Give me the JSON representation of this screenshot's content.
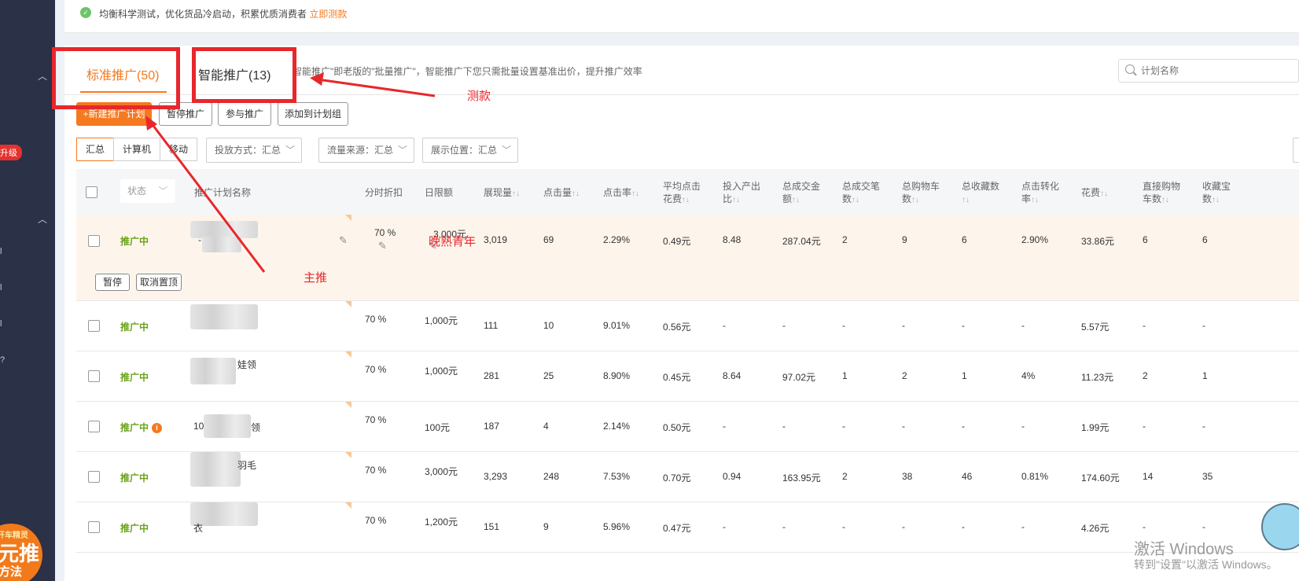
{
  "notice": {
    "text": "均衡科学测试，优化货品冷启动，积累优质消费者",
    "link": "立即测款"
  },
  "sidebar": {
    "badge": "升级",
    "promo_line1": "开车精灵",
    "promo_line2": "元推",
    "promo_line3": "方法"
  },
  "tabs": {
    "standard": "标准推广(50)",
    "smart": "智能推广(13)",
    "description": "智能推广\"即老版的\"批量推广\"，智能推广下您只需批量设置基准出价，提升推广效率"
  },
  "search": {
    "placeholder": "计划名称"
  },
  "toolbar": {
    "new_plan": "+新建推广计划",
    "pause": "暂停推广",
    "join": "参与推广",
    "add_group": "添加到计划组"
  },
  "filters": {
    "segments": [
      "汇总",
      "计算机",
      "移动"
    ],
    "delivery": "投放方式：汇总",
    "traffic": "流量来源：汇总",
    "placement": "展示位置：汇总"
  },
  "table": {
    "status_filter": "状态",
    "headers": {
      "name": "推广计划名称",
      "discount": "分时折扣",
      "budget": "日限额",
      "impressions": "展现量",
      "clicks": "点击量",
      "ctr": "点击率",
      "avg_cpc_1": "平均点击",
      "avg_cpc_2": "花费",
      "roi_1": "投入产出",
      "roi_2": "比",
      "gmv_1": "总成交金",
      "gmv_2": "额",
      "orders_1": "总成交笔",
      "orders_2": "数",
      "cart_1": "总购物车",
      "cart_2": "数",
      "fav_1": "总收藏数",
      "fav_2": "",
      "cvr_1": "点击转化",
      "cvr_2": "率",
      "cost": "花费",
      "direct_cart_1": "直接购物",
      "direct_cart_2": "车数",
      "fav_item_1": "收藏宝",
      "fav_item_2": "数"
    },
    "sort_glyph": "↑↓",
    "row_actions": {
      "pause": "暂停",
      "unpin": "取消置顶"
    },
    "rows": [
      {
        "status": "推广中",
        "name": "-",
        "discount": "70 %",
        "budget": "3,000元",
        "impressions": "3,019",
        "clicks": "69",
        "ctr": "2.29%",
        "cpc": "0.49元",
        "roi": "8.48",
        "gmv": "287.04元",
        "orders": "2",
        "cart": "9",
        "fav": "6",
        "cvr": "2.90%",
        "cost": "33.86元",
        "direct_cart": "6",
        "fav_item": "6"
      },
      {
        "status": "推广中",
        "name": "",
        "discount": "70 %",
        "budget": "1,000元",
        "impressions": "111",
        "clicks": "10",
        "ctr": "9.01%",
        "cpc": "0.56元",
        "roi": "-",
        "gmv": "-",
        "orders": "-",
        "cart": "-",
        "fav": "-",
        "cvr": "-",
        "cost": "5.57元",
        "direct_cart": "-",
        "fav_item": "-"
      },
      {
        "status": "推广中",
        "name": "娃领",
        "discount": "70 %",
        "budget": "1,000元",
        "impressions": "281",
        "clicks": "25",
        "ctr": "8.90%",
        "cpc": "0.45元",
        "roi": "8.64",
        "gmv": "97.02元",
        "orders": "1",
        "cart": "2",
        "fav": "1",
        "cvr": "4%",
        "cost": "11.23元",
        "direct_cart": "2",
        "fav_item": "1"
      },
      {
        "status": "推广中",
        "name": "10",
        "name_tail": "领",
        "discount": "70 %",
        "budget": "100元",
        "impressions": "187",
        "clicks": "4",
        "ctr": "2.14%",
        "cpc": "0.50元",
        "roi": "-",
        "gmv": "-",
        "orders": "-",
        "cart": "-",
        "fav": "-",
        "cvr": "-",
        "cost": "1.99元",
        "direct_cart": "-",
        "fav_item": "-"
      },
      {
        "status": "推广中",
        "name": "羽毛",
        "discount": "70 %",
        "budget": "3,000元",
        "impressions": "3,293",
        "clicks": "248",
        "ctr": "7.53%",
        "cpc": "0.70元",
        "roi": "0.94",
        "gmv": "163.95元",
        "orders": "2",
        "cart": "38",
        "fav": "46",
        "cvr": "0.81%",
        "cost": "174.60元",
        "direct_cart": "14",
        "fav_item": "35"
      },
      {
        "status": "推广中",
        "name": "衣",
        "discount": "70 %",
        "budget": "1,200元",
        "impressions": "151",
        "clicks": "9",
        "ctr": "5.96%",
        "cpc": "0.47元",
        "roi": "-",
        "gmv": "-",
        "orders": "-",
        "cart": "-",
        "fav": "-",
        "cvr": "-",
        "cost": "4.26元",
        "direct_cart": "-",
        "fav_item": "-"
      }
    ]
  },
  "annotations": {
    "test": "测款",
    "main": "主推",
    "youth": "晚熟青年"
  },
  "watermark": {
    "line1": "激活 Windows",
    "line2": "转到\"设置\"以激活 Windows。"
  },
  "colors": {
    "accent": "#f5791f",
    "status_green": "#6aa21a",
    "annotation_red": "#e8272c",
    "sidebar": "#2b3147"
  }
}
